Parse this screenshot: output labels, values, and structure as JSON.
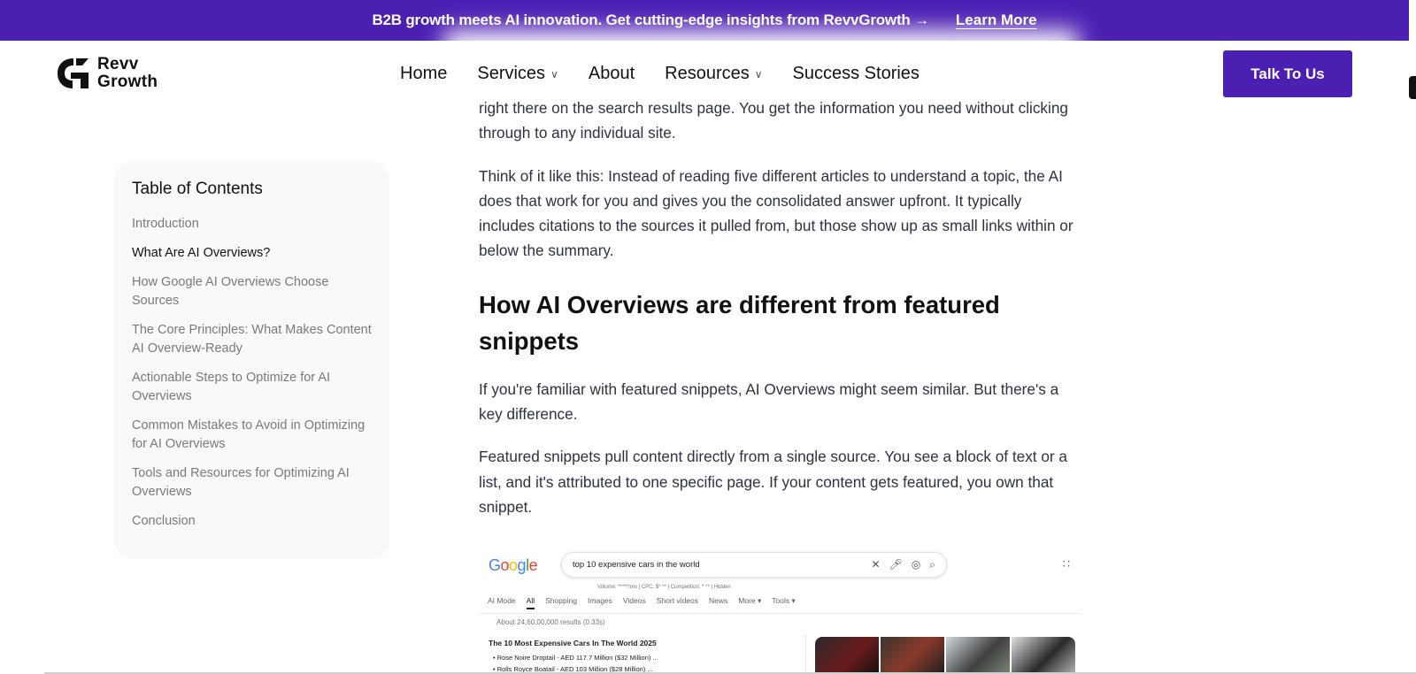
{
  "announcement": {
    "text": "B2B growth meets AI innovation. Get cutting-edge insights from RevvGrowth →",
    "link_label": "Learn More"
  },
  "header": {
    "logo_line1": "Revv",
    "logo_line2": "Growth",
    "nav": [
      {
        "label": "Home",
        "has_dropdown": false
      },
      {
        "label": "Services",
        "has_dropdown": true
      },
      {
        "label": "About",
        "has_dropdown": false
      },
      {
        "label": "Resources",
        "has_dropdown": true
      },
      {
        "label": "Success Stories",
        "has_dropdown": false
      }
    ],
    "cta_label": "Talk To Us"
  },
  "toc": {
    "title": "Table of Contents",
    "items": [
      {
        "label": "Introduction",
        "active": false
      },
      {
        "label": "What Are AI Overviews?",
        "active": true
      },
      {
        "label": "How Google AI Overviews Choose Sources",
        "active": false
      },
      {
        "label": "The Core Principles: What Makes Content AI Overview-Ready",
        "active": false
      },
      {
        "label": "Actionable Steps to Optimize for AI Overviews",
        "active": false
      },
      {
        "label": "Common Mistakes to Avoid in Optimizing for AI Overviews",
        "active": false
      },
      {
        "label": "Tools and Resources for Optimizing AI Overviews",
        "active": false
      },
      {
        "label": "Conclusion",
        "active": false
      }
    ]
  },
  "article": {
    "p0": "right there on the search results page. You get the information you need without clicking through to any individual site.",
    "p1": "Think of it like this: Instead of reading five different articles to understand a topic, the AI does that work for you and gives you the consolidated answer upfront. It typically includes citations to the sources it pulled from, but those show up as small links within or below the summary.",
    "h2": "How AI Overviews are different from featured snippets",
    "p2": "If you're familiar with featured snippets, AI Overviews might seem similar. But there's a key difference.",
    "p3": "Featured snippets pull content directly from a single source. You see a block of text or a list, and it's attributed to one specific page. If your content gets featured, you own that snippet."
  },
  "figure": {
    "logo": "Google",
    "query": "top 10 expensive cars in the world",
    "volume": "Volume: *****/mo | CPC: $* ** | Competition: * ** | Hidden",
    "tabs": [
      "AI Mode",
      "All",
      "Shopping",
      "Images",
      "Videos",
      "Short videos",
      "News",
      "More ▾",
      "Tools ▾"
    ],
    "selected_tab": "All",
    "results_count": "About 24,60,00,000 results (0.33s)",
    "result_title": "The 10 Most Expensive Cars In The World 2025",
    "bullets": [
      "Rose Noire Droptail - AED 117.7 Million ($32 Million) ...",
      "Rolls Royce Boatail - AED 103 Million ($28 Million) ..."
    ]
  },
  "colors": {
    "brand": "#4c1fb3",
    "text": "#2d3142"
  }
}
